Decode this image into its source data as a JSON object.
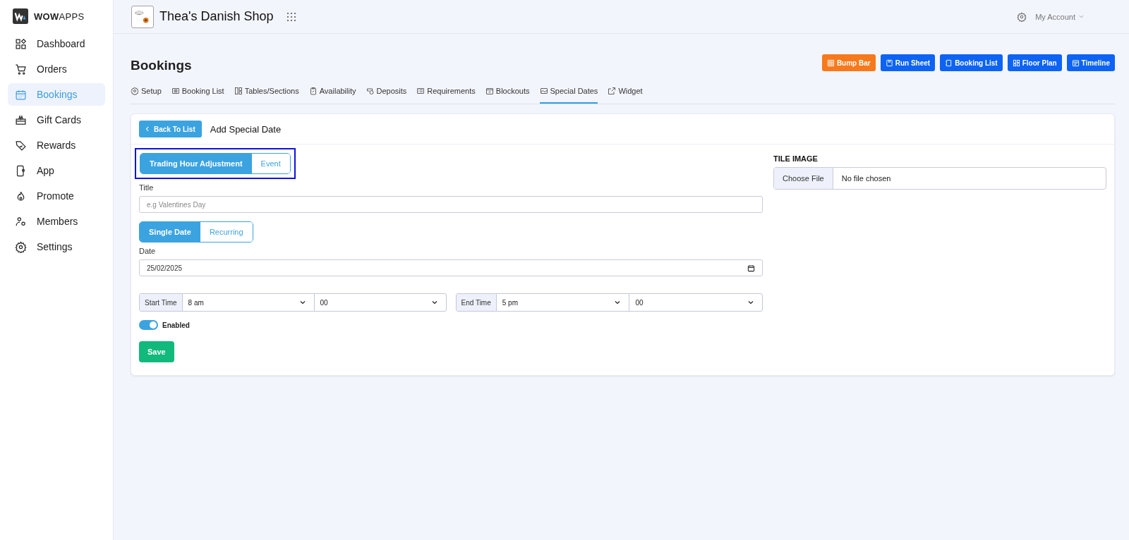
{
  "sidebar": {
    "logo": "**WOW**APPS",
    "items": [
      {
        "label": "Dashboard",
        "selected": false
      },
      {
        "label": "Orders",
        "selected": false
      },
      {
        "label": "Bookings",
        "selected": true
      },
      {
        "label": "Gift Cards",
        "selected": false
      },
      {
        "label": "Rewards",
        "selected": false
      },
      {
        "label": "App",
        "selected": false
      },
      {
        "label": "Promote",
        "selected": false
      },
      {
        "label": "Members",
        "selected": false
      },
      {
        "label": "Settings",
        "selected": false
      }
    ]
  },
  "topbar": {
    "shop_name": "Thea's Danish Shop",
    "account": "My Account"
  },
  "page": {
    "title": "Bookings",
    "actions": [
      {
        "label": "Bump Bar",
        "kind": "warning"
      },
      {
        "label": "Run Sheet",
        "kind": "primary"
      },
      {
        "label": "Booking List",
        "kind": "primary"
      },
      {
        "label": "Floor Plan",
        "kind": "primary"
      },
      {
        "label": "Timeline",
        "kind": "primary"
      }
    ]
  },
  "tabs": [
    {
      "label": "Setup",
      "selected": false
    },
    {
      "label": "Booking List",
      "selected": false
    },
    {
      "label": "Tables/Sections",
      "selected": false
    },
    {
      "label": "Availability",
      "selected": false
    },
    {
      "label": "Deposits",
      "selected": false
    },
    {
      "label": "Requirements",
      "selected": false
    },
    {
      "label": "Blockouts",
      "selected": false
    },
    {
      "label": "Special Dates",
      "selected": true
    },
    {
      "label": "Widget",
      "selected": false
    }
  ],
  "form": {
    "back_button": "Back To List",
    "heading": "Add Special Date",
    "type_toggle": {
      "focused": true,
      "options": [
        {
          "label": "Trading Hour Adjustment",
          "selected": true
        },
        {
          "label": "Event",
          "selected": false
        }
      ]
    },
    "title_label": "Title",
    "title_placeholder": "e.g Valentines Day",
    "date_mode": {
      "options": [
        {
          "label": "Single Date",
          "selected": true
        },
        {
          "label": "Recurring",
          "selected": false
        }
      ]
    },
    "date_label": "Date",
    "date_value": "25/02/2025",
    "times": [
      {
        "label": "Start Time",
        "hour": "8 am",
        "minute": "00"
      },
      {
        "label": "End Time",
        "hour": "5 pm",
        "minute": "00"
      }
    ],
    "enabled": {
      "label": "Enabled",
      "on": true
    },
    "save": "Save",
    "tile_image": {
      "label": "TILE IMAGE",
      "button": "Choose File",
      "status": "No file chosen"
    }
  }
}
